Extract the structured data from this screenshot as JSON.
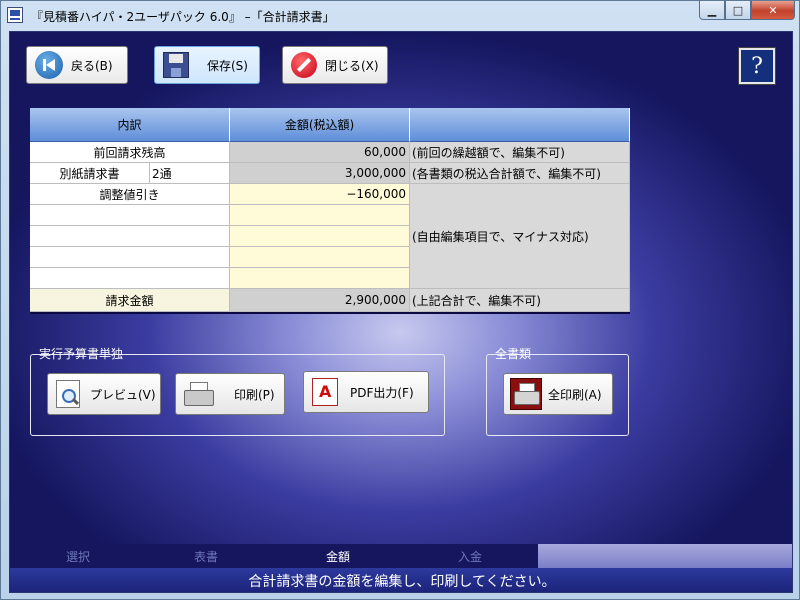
{
  "window": {
    "title": "『見積番ハイパ・2ユーザパック 6.0』 –「合計請求書」",
    "min_glyph": "▁",
    "max_glyph": "□",
    "close_glyph": "✕"
  },
  "toolbar": {
    "back_label": "戻る(B)",
    "save_label": "保存(S)",
    "close_label": "閉じる(X)",
    "help_glyph": "?"
  },
  "table": {
    "headers": [
      "内訳",
      "金額(税込額)",
      ""
    ],
    "rows": {
      "prev": {
        "label": "前回請求残高",
        "amount": "60,000",
        "note": "(前回の繰越額で、編集不可)"
      },
      "sep": {
        "label": "別紙請求書",
        "count": "2通",
        "amount": "3,000,000",
        "note": "(各書類の税込合計額で、編集不可)"
      },
      "adj": {
        "label": "調整値引き",
        "amount": "−160,000"
      },
      "free_note": "(自由編集項目で、マイナス対応)",
      "total": {
        "label": "請求金額",
        "amount": "2,900,000",
        "note": "(上記合計で、編集不可)"
      }
    }
  },
  "group_exec": {
    "title": "実行予算書単独",
    "preview_label": "プレビュ(V)",
    "print_label": "印刷(P)",
    "pdf_label": "PDF出力(F)"
  },
  "group_all": {
    "title": "全書類",
    "printall_label": "全印刷(A)"
  },
  "tabs": [
    "選択",
    "表書",
    "金額",
    "入金"
  ],
  "selected_tab": "金額",
  "status": "合計請求書の金額を編集し、印刷してください。"
}
